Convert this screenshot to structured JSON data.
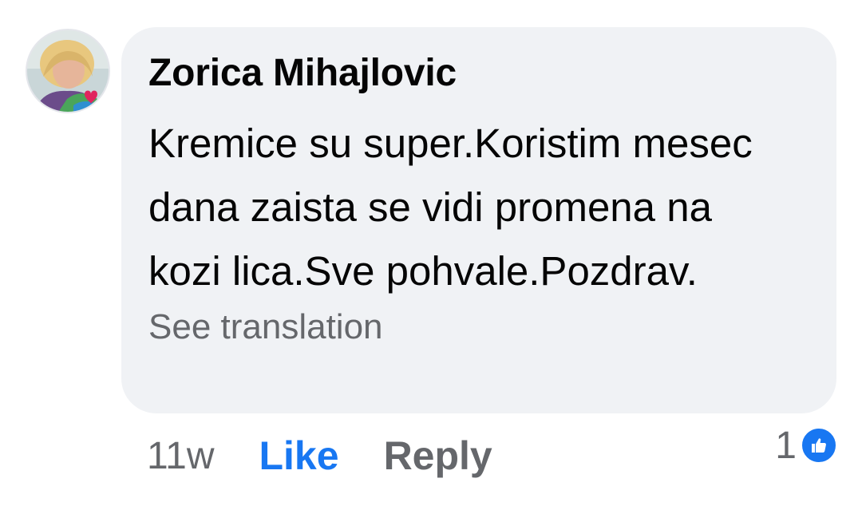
{
  "comment": {
    "author": "Zorica Mihajlovic",
    "text": "Kremice su super.Koristim mesec dana zaista se vidi promena na kozi lica.Sve pohvale.Pozdrav.",
    "translate_label": "See translation"
  },
  "actions": {
    "timestamp": "11w",
    "like_label": "Like",
    "reply_label": "Reply"
  },
  "reactions": {
    "count": "1",
    "icon": "thumbs-up-icon"
  },
  "colors": {
    "bubble_bg": "#f0f2f5",
    "link_blue": "#1877f2",
    "secondary_text": "#65676b",
    "primary_text": "#050505"
  }
}
